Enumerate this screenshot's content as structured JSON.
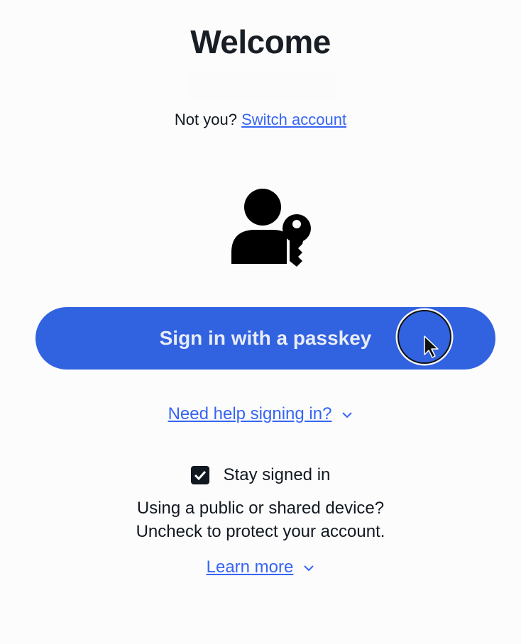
{
  "page": {
    "title": "Welcome"
  },
  "account": {
    "not_you_text": "Not you?",
    "switch_label": "Switch account"
  },
  "passkey": {
    "icon": "user-key-icon",
    "button_label": "Sign in with a passkey"
  },
  "help": {
    "label": "Need help signing in?",
    "icon": "chevron-down-icon"
  },
  "stay_signed_in": {
    "label": "Stay signed in",
    "checked": true,
    "info_line1": "Using a public or shared device?",
    "info_line2": "Uncheck to protect your account."
  },
  "learn_more": {
    "label": "Learn more",
    "icon": "chevron-down-icon"
  },
  "colors": {
    "primary": "#3162df",
    "link": "#3665f3",
    "text": "#111820",
    "background": "#fcfcfd"
  }
}
